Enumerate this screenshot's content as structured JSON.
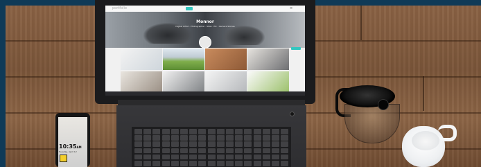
{
  "screen": {
    "site_logo": "portfolio",
    "profile_name": "Monnor",
    "profile_subtitle": "Digital Artist · Photographer · Sites · Pix · Camera Stories",
    "profile_tabs": "Work   Profile   Likes   Stats   Following"
  },
  "phone": {
    "time": "10:35",
    "ampm": "AM",
    "date": "Tuesday, April 12"
  }
}
